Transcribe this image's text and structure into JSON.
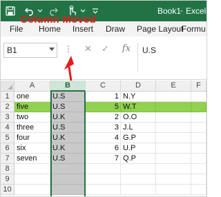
{
  "titlebar": {
    "icons": [
      "autosave-icon",
      "undo-icon",
      "redo-icon",
      "touch-mode-icon",
      "more-icon"
    ],
    "book_title": "Book1",
    "separator": "-",
    "app_name": "Excel"
  },
  "ribbon": {
    "tabs": [
      "File",
      "Home",
      "Insert",
      "Draw",
      "Page Layout",
      "Formu"
    ]
  },
  "formula_bar": {
    "name_box": "B1",
    "dots": "⋮",
    "cancel_glyph": "✕",
    "enter_glyph": "✓",
    "fx_label": "fx",
    "formula_value": "U.S"
  },
  "annotation": {
    "callout_text": "Column Moved",
    "color": "#e41b1b"
  },
  "grid": {
    "columns": [
      "A",
      "B",
      "C",
      "D",
      "E",
      "F"
    ],
    "rows": [
      "1",
      "2",
      "3",
      "4",
      "5",
      "6",
      "7",
      "8",
      "9",
      "10"
    ],
    "selected_column": "B",
    "highlight_row": "2",
    "highlight_color": "#92d050",
    "data": [
      {
        "a": "one",
        "b": "U.S",
        "c": "1",
        "d": "N.Y"
      },
      {
        "a": "five",
        "b": "U.S",
        "c": "5",
        "d": "W.T"
      },
      {
        "a": "two",
        "b": "U.K",
        "c": "2",
        "d": "O.O"
      },
      {
        "a": "three",
        "b": "U.S",
        "c": "3",
        "d": "J.L"
      },
      {
        "a": "four",
        "b": "U.K",
        "c": "4",
        "d": "G.P"
      },
      {
        "a": "six",
        "b": "U.K",
        "c": "6",
        "d": "U.P"
      },
      {
        "a": "seven",
        "b": "U.S",
        "c": "7",
        "d": "Q.P"
      }
    ]
  },
  "colors": {
    "excel_green": "#217346",
    "selected_column_fill": "#c9c9c9",
    "ribbon_bg": "#f3f3f3"
  }
}
